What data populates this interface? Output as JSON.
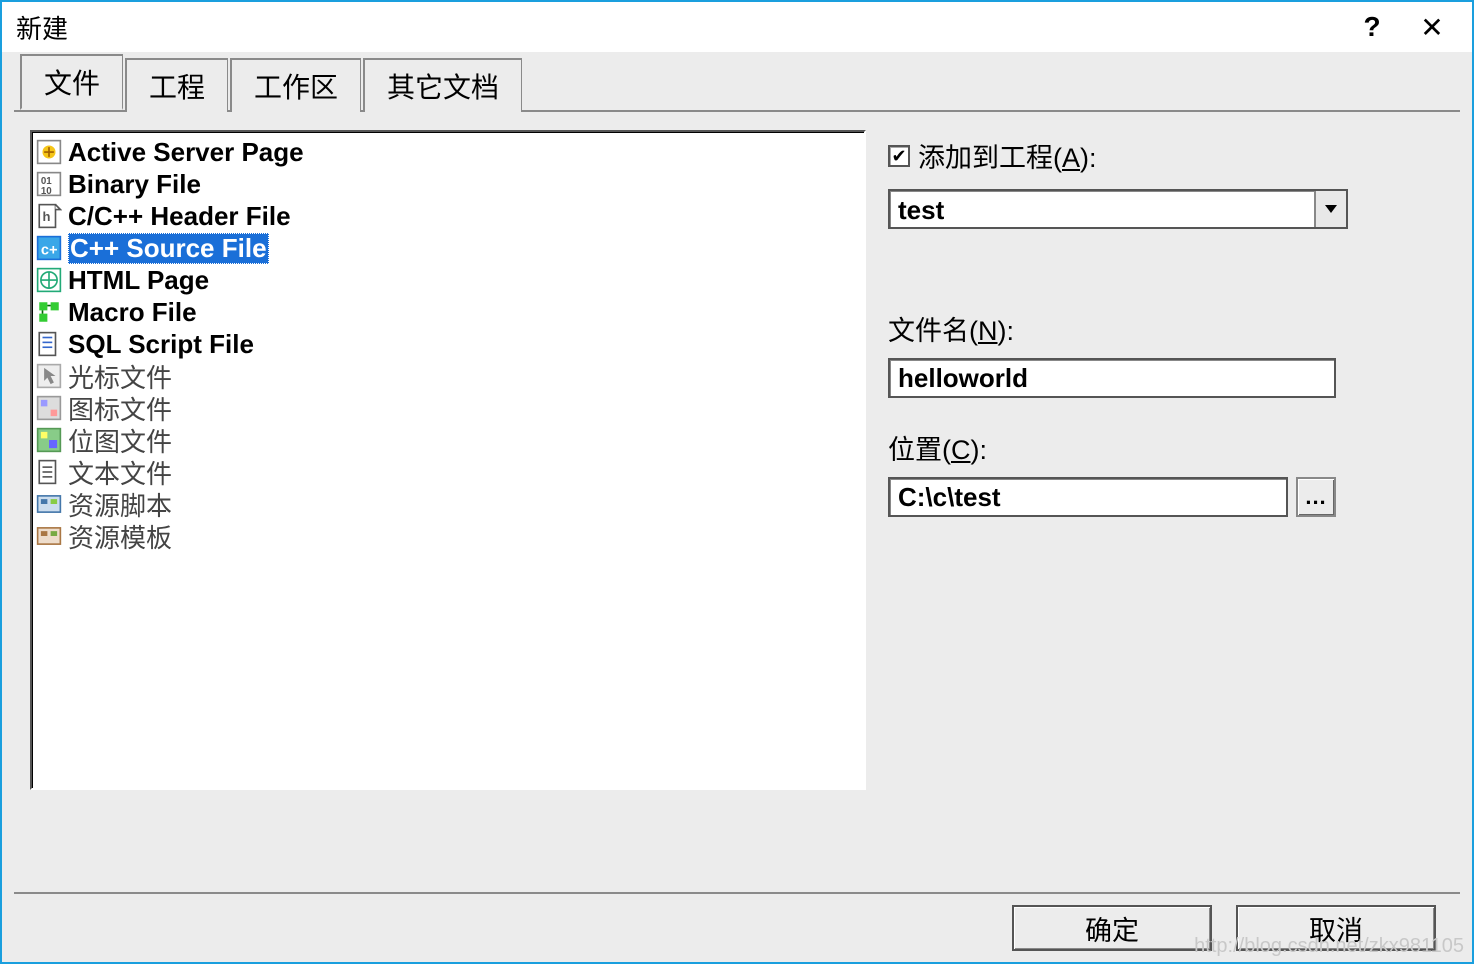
{
  "window": {
    "title": "新建",
    "help_symbol": "?",
    "close_symbol": "✕"
  },
  "tabs": [
    {
      "label": "文件",
      "active": true
    },
    {
      "label": "工程",
      "active": false
    },
    {
      "label": "工作区",
      "active": false
    },
    {
      "label": "其它文档",
      "active": false
    }
  ],
  "file_types": [
    {
      "label": "Active Server Page",
      "icon": "asp"
    },
    {
      "label": "Binary File",
      "icon": "binary"
    },
    {
      "label": "C/C++ Header File",
      "icon": "header"
    },
    {
      "label": "C++ Source File",
      "icon": "cpp",
      "selected": true
    },
    {
      "label": "HTML Page",
      "icon": "html"
    },
    {
      "label": "Macro File",
      "icon": "macro"
    },
    {
      "label": "SQL Script File",
      "icon": "sql"
    },
    {
      "label": "光标文件",
      "icon": "cursor",
      "dim": true
    },
    {
      "label": "图标文件",
      "icon": "icon",
      "dim": true
    },
    {
      "label": "位图文件",
      "icon": "bitmap",
      "dim": true
    },
    {
      "label": "文本文件",
      "icon": "text",
      "dim": true
    },
    {
      "label": "资源脚本",
      "icon": "resscript",
      "dim": true
    },
    {
      "label": "资源模板",
      "icon": "restmpl",
      "dim": true
    }
  ],
  "form": {
    "add_to_project": {
      "label_pre": "添加到工程(",
      "accel": "A",
      "label_post": "):",
      "checked": true
    },
    "project_combo": {
      "value": "test"
    },
    "filename": {
      "label_pre": "文件名(",
      "accel": "N",
      "label_post": "):",
      "value": "helloworld"
    },
    "location": {
      "label_pre": "位置(",
      "accel": "C",
      "label_post": "):",
      "value": "C:\\c\\test",
      "browse": "..."
    }
  },
  "buttons": {
    "ok": "确定",
    "cancel": "取消"
  },
  "watermark": "http://blog.csdn.net/zkx981105"
}
